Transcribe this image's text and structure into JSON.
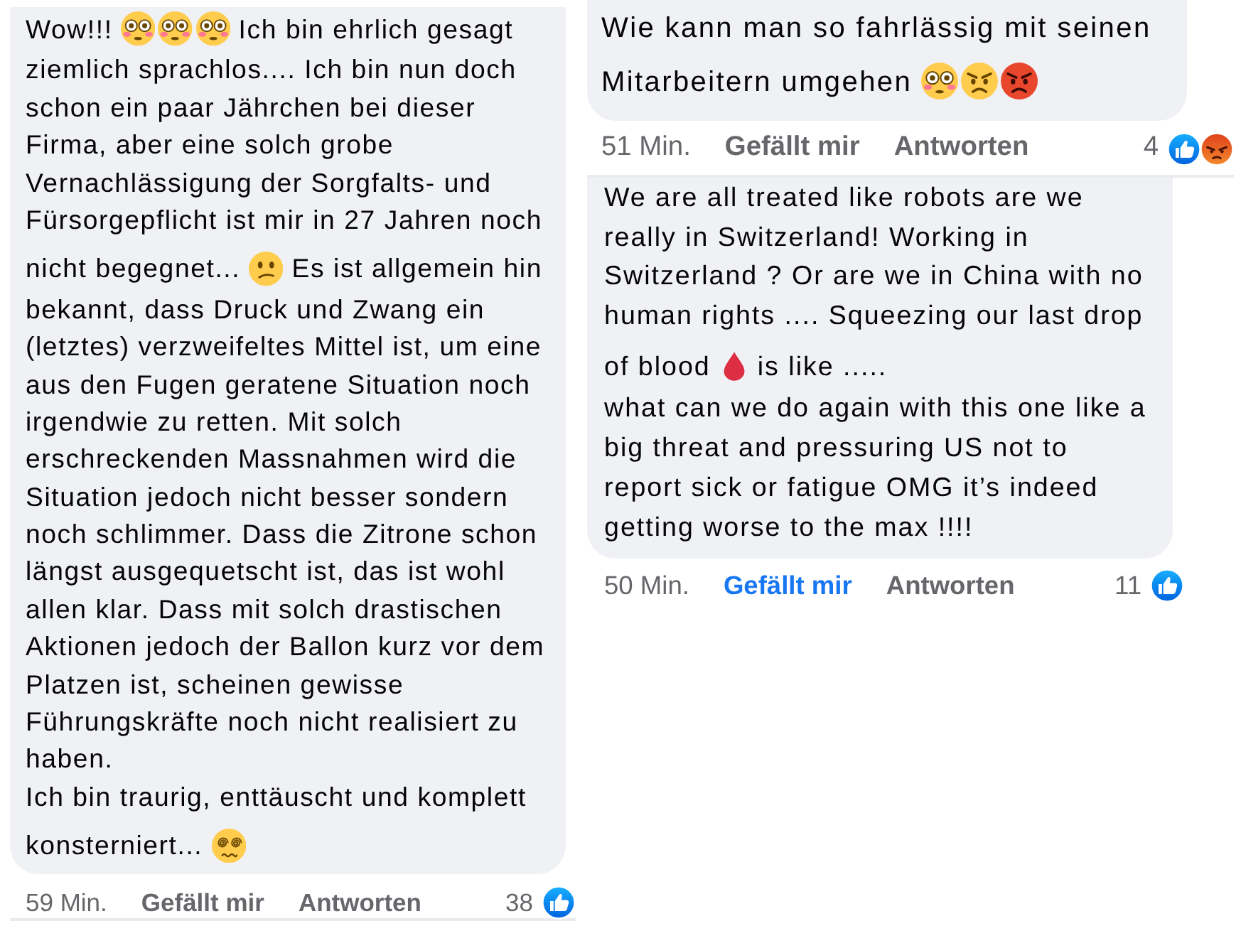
{
  "columns": [
    {
      "comments": [
        {
          "lines": [
            [
              {
                "kind": "text",
                "text": "Wow!!!"
              },
              {
                "kind": "flushed"
              },
              {
                "kind": "flushed"
              },
              {
                "kind": "flushed"
              },
              {
                "kind": "text",
                "text": "Ich bin ehrlich gesagt"
              }
            ],
            [
              {
                "kind": "text",
                "text": "ziemlich sprachlos.... Ich bin nun doch"
              }
            ],
            [
              {
                "kind": "text",
                "text": "schon ein paar Jährchen bei dieser"
              }
            ],
            [
              {
                "kind": "text",
                "text": "Firma, aber eine solch grobe"
              }
            ],
            [
              {
                "kind": "text",
                "text": "Vernachlässigung der Sorgfalts- und"
              }
            ],
            [
              {
                "kind": "text",
                "text": "Fürsorgepflicht ist mir in 27 Jahren noch"
              }
            ],
            [
              {
                "kind": "text",
                "text": "nicht begegnet..."
              },
              {
                "kind": "confused"
              },
              {
                "kind": "text",
                "text": "Es ist allgemein hin"
              }
            ],
            [
              {
                "kind": "text",
                "text": "bekannt, dass Druck und Zwang ein"
              }
            ],
            [
              {
                "kind": "text",
                "text": "(letztes) verzweifeltes Mittel ist, um eine"
              }
            ],
            [
              {
                "kind": "text",
                "text": "aus den Fugen geratene Situation noch"
              }
            ],
            [
              {
                "kind": "text",
                "text": "irgendwie zu retten. Mit solch"
              }
            ],
            [
              {
                "kind": "text",
                "text": "erschreckenden Massnahmen wird die"
              }
            ],
            [
              {
                "kind": "text",
                "text": "Situation jedoch nicht besser sondern"
              }
            ],
            [
              {
                "kind": "text",
                "text": "noch schlimmer. Dass die Zitrone schon"
              }
            ],
            [
              {
                "kind": "text",
                "text": "längst ausgequetscht ist, das ist wohl"
              }
            ],
            [
              {
                "kind": "text",
                "text": "allen klar. Dass mit solch drastischen"
              }
            ],
            [
              {
                "kind": "text",
                "text": "Aktionen jedoch der Ballon kurz vor dem"
              }
            ],
            [
              {
                "kind": "text",
                "text": "Platzen ist, scheinen gewisse"
              }
            ],
            [
              {
                "kind": "text",
                "text": "Führungskräfte noch nicht realisiert zu"
              }
            ],
            [
              {
                "kind": "text",
                "text": "haben."
              }
            ],
            [
              {
                "kind": "text",
                "text": "Ich bin traurig, enttäuscht und komplett"
              }
            ],
            [
              {
                "kind": "text",
                "text": "konsterniert..."
              },
              {
                "kind": "dizzy"
              }
            ]
          ],
          "time": "59 Min.",
          "like": {
            "label": "Gefällt mir",
            "selected": false
          },
          "reply": "Antworten",
          "reaction_count": "38",
          "reactions": [
            {
              "kind": "like"
            }
          ]
        }
      ]
    },
    {
      "comments": [
        {
          "lines": [
            [
              {
                "kind": "text",
                "text": "Wie kann man so fahrlässig mit seinen"
              }
            ],
            [
              {
                "kind": "text",
                "text": "Mitarbeitern umgehen"
              },
              {
                "kind": "flushed"
              },
              {
                "kind": "angry"
              },
              {
                "kind": "pouting"
              }
            ]
          ],
          "time": "51 Min.",
          "like": {
            "label": "Gefällt mir",
            "selected": false
          },
          "reply": "Antworten",
          "reaction_count": "4",
          "reactions": [
            {
              "kind": "like"
            },
            {
              "kind": "angry"
            }
          ]
        },
        {
          "lines": [
            [
              {
                "kind": "text",
                "text": "We are all treated like robots are we"
              }
            ],
            [
              {
                "kind": "text",
                "text": "really in Switzerland! Working in"
              }
            ],
            [
              {
                "kind": "text",
                "text": "Switzerland ? Or are we in China with no"
              }
            ],
            [
              {
                "kind": "text",
                "text": "human rights .... Squeezing our last drop"
              }
            ],
            [
              {
                "kind": "text",
                "text": "of blood"
              },
              {
                "kind": "drop"
              },
              {
                "kind": "text",
                "text": "is like ....."
              }
            ],
            [
              {
                "kind": "text",
                "text": "what can we do again with this one like a"
              }
            ],
            [
              {
                "kind": "text",
                "text": "big threat and pressuring US not to"
              }
            ],
            [
              {
                "kind": "text",
                "text": "report sick or fatigue OMG it’s indeed"
              }
            ],
            [
              {
                "kind": "text",
                "text": "getting worse to the max !!!!"
              }
            ]
          ],
          "time": "50 Min.",
          "like": {
            "label": "Gefällt mir",
            "selected": true
          },
          "reply": "Antworten",
          "reaction_count": "11",
          "reactions": [
            {
              "kind": "like"
            }
          ]
        }
      ]
    }
  ]
}
